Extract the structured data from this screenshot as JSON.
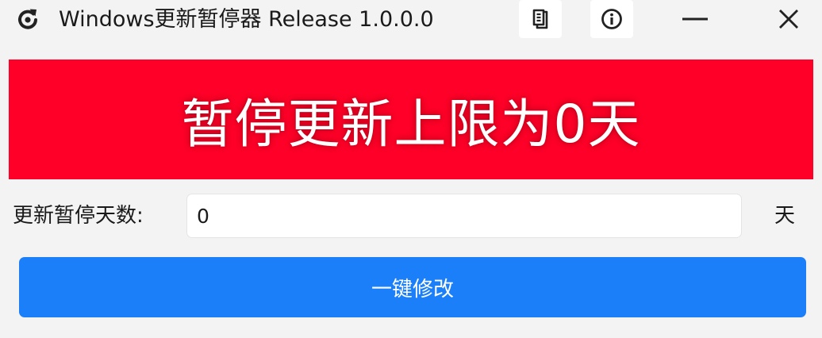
{
  "window": {
    "title": "Windows更新暂停器 Release 1.0.0.0",
    "app_icon": "refresh-icon"
  },
  "titlebar": {
    "log_icon": "document-icon",
    "about_icon": "info-icon",
    "minimize_icon": "minimize-icon",
    "close_icon": "close-icon"
  },
  "banner": {
    "text": "暂停更新上限为0天",
    "background": "#ff0029",
    "text_color": "#ffffff"
  },
  "form": {
    "days_label": "更新暂停天数:",
    "days_value": "0",
    "unit": "天"
  },
  "actions": {
    "modify_label": "一键修改",
    "accent": "#1a7ff8"
  }
}
